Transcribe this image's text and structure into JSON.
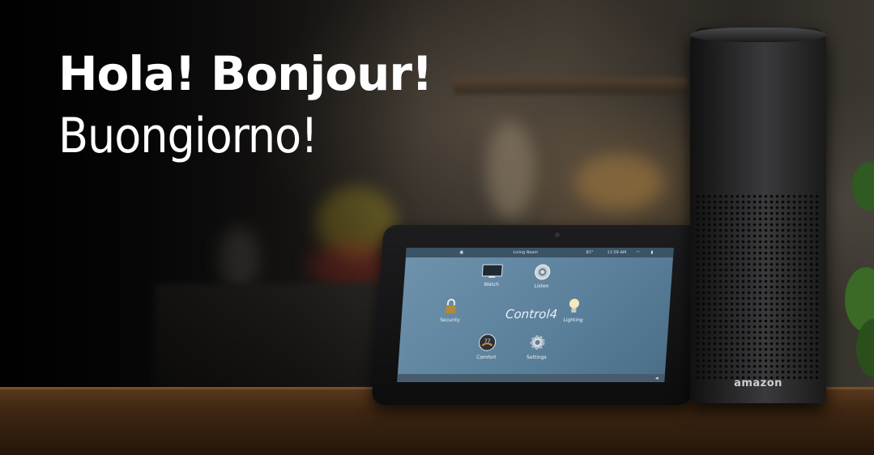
{
  "headline": {
    "line1": "Hola! Bonjour!",
    "line2": "Buongiorno!"
  },
  "tablet": {
    "room": "Living Room",
    "temp": "81°",
    "time": "11:59 AM",
    "brand": "Control4",
    "tiles": {
      "watch": "Watch",
      "listen": "Listen",
      "security": "Security",
      "lighting": "Lighting",
      "comfort": "Comfort",
      "settings": "Settings",
      "thermostat_value": "77"
    }
  },
  "speaker": {
    "logo": "amazon"
  },
  "colors": {
    "screen": "#5f86a2",
    "tablet_bezel": "#141415",
    "speaker_body": "#2b2b2d",
    "table_wood": "#4a2f17"
  }
}
